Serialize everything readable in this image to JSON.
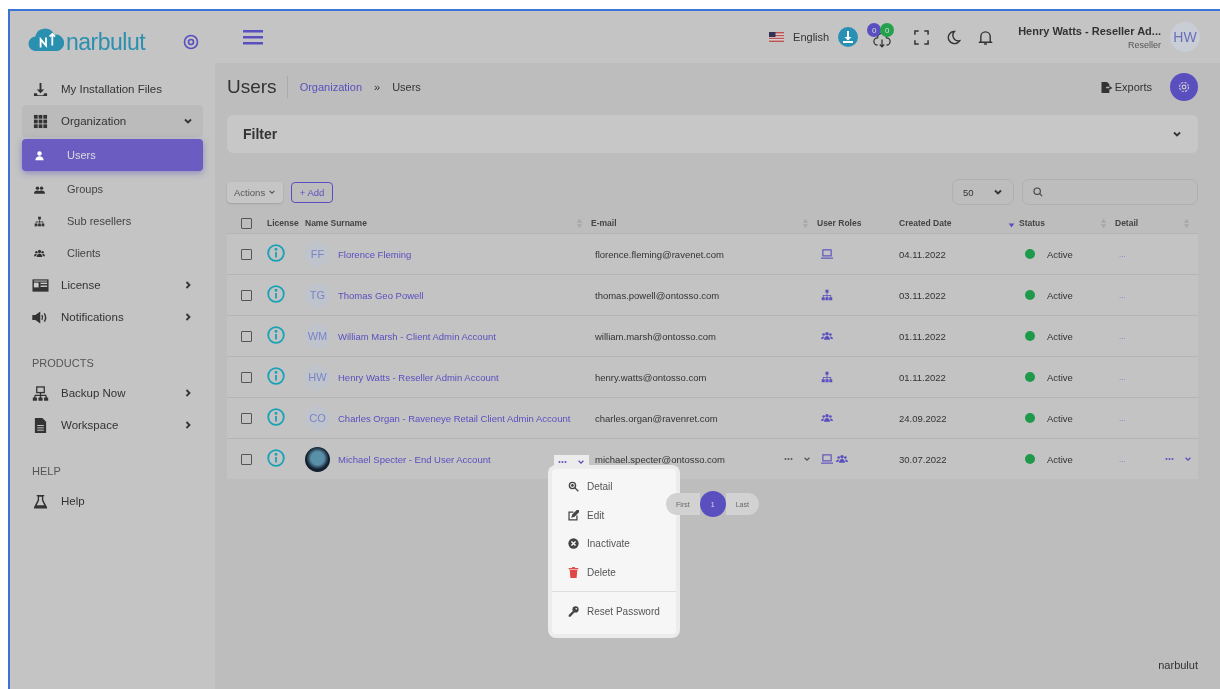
{
  "brand": {
    "name": "narbulut"
  },
  "sidebar": {
    "groups": [
      {
        "items": [
          {
            "label": "My Installation Files",
            "kind": "download"
          },
          {
            "label": "Organization",
            "kind": "grid",
            "expanded": true,
            "children": [
              {
                "label": "Users",
                "kind": "user",
                "selected": true
              },
              {
                "label": "Groups",
                "kind": "users",
                "selected": false
              },
              {
                "label": "Sub resellers",
                "kind": "sitemap",
                "selected": false
              },
              {
                "label": "Clients",
                "kind": "people",
                "selected": false
              }
            ]
          },
          {
            "label": "License",
            "kind": "card",
            "expanded": false
          },
          {
            "label": "Notifications",
            "kind": "speaker",
            "expanded": false
          }
        ]
      },
      {
        "heading": "PRODUCTS",
        "items": [
          {
            "label": "Backup Now",
            "kind": "network",
            "expanded": false
          },
          {
            "label": "Workspace",
            "kind": "file",
            "expanded": false
          }
        ]
      },
      {
        "heading": "HELP",
        "items": [
          {
            "label": "Help",
            "kind": "flask"
          }
        ]
      }
    ]
  },
  "topbar": {
    "language": "English",
    "badges": [
      {
        "count": "0",
        "color": "#5a4fc0"
      },
      {
        "count": "0",
        "color": "#23a14c"
      }
    ],
    "user_name": "Henry Watts - Reseller Ad...",
    "user_role": "Reseller",
    "user_initials": "HW"
  },
  "page": {
    "title": "Users",
    "breadcrumb": [
      "Organization",
      "Users"
    ],
    "separator": "»",
    "exports": "Exports"
  },
  "filter": {
    "title": "Filter",
    "expanded": false
  },
  "toolbar": {
    "actions": "Actions",
    "add": "+ Add",
    "page_size": "50"
  },
  "table": {
    "all_checked": false,
    "columns": [
      {
        "label": "License",
        "kind": "plain"
      },
      {
        "label": "Name Surname",
        "kind": "sortable"
      },
      {
        "label": "E-mail",
        "kind": "sortable"
      },
      {
        "label": "User Roles",
        "kind": "plain"
      },
      {
        "label": "Created Date",
        "kind": "sorted-desc"
      },
      {
        "label": "Status",
        "kind": "sortable"
      },
      {
        "label": "Detail",
        "kind": "sortable"
      }
    ],
    "rows": [
      {
        "checked": false,
        "avatar": {
          "kind": "initials",
          "text": "FF"
        },
        "name": "Florence Fleming",
        "email": "florence.fleming@ravenet.com",
        "roles": [
          {
            "kind": "computer"
          }
        ],
        "created": "04.11.2022",
        "status": "Active",
        "color": "#1f9a4a",
        "detail": "...",
        "hovered": false
      },
      {
        "checked": false,
        "avatar": {
          "kind": "initials",
          "text": "TG"
        },
        "name": "Thomas Geo Powell",
        "email": "thomas.powell@ontosso.com",
        "roles": [
          {
            "kind": "sitemap"
          }
        ],
        "created": "03.11.2022",
        "status": "Active",
        "color": "#1f9a4a",
        "detail": "...",
        "hovered": false
      },
      {
        "checked": false,
        "avatar": {
          "kind": "initials",
          "text": "WM"
        },
        "name": "William Marsh - Client Admin Account",
        "email": "william.marsh@ontosso.com",
        "roles": [
          {
            "kind": "people"
          }
        ],
        "created": "01.11.2022",
        "status": "Active",
        "color": "#1f9a4a",
        "detail": "...",
        "hovered": false
      },
      {
        "checked": false,
        "avatar": {
          "kind": "initials",
          "text": "HW"
        },
        "name": "Henry Watts - Reseller Admin Account",
        "email": "henry.watts@ontosso.com",
        "roles": [
          {
            "kind": "sitemap"
          }
        ],
        "created": "01.11.2022",
        "status": "Active",
        "color": "#1f9a4a",
        "detail": "...",
        "hovered": false
      },
      {
        "checked": false,
        "avatar": {
          "kind": "initials",
          "text": "CO"
        },
        "name": "Charles Organ - Raveneye Retail Client Admin Account",
        "email": "charles.organ@ravenret.com",
        "roles": [
          {
            "kind": "people"
          }
        ],
        "created": "24.09.2022",
        "status": "Active",
        "color": "#1f9a4a",
        "detail": "...",
        "hovered": false
      },
      {
        "checked": false,
        "avatar": {
          "kind": "photo"
        },
        "name": "Michael Specter - End User Account",
        "email": "michael.specter@ontosso.com",
        "roles": [
          {
            "kind": "computer"
          },
          {
            "kind": "people"
          }
        ],
        "created": "30.07.2022",
        "status": "Active",
        "color": "#1f9a4a",
        "detail": "...",
        "hovered": true
      }
    ]
  },
  "row_menu": {
    "open": true,
    "items": [
      {
        "label": "Detail",
        "kind": "zoom",
        "separated": false
      },
      {
        "label": "Edit",
        "kind": "edit",
        "separated": false
      },
      {
        "label": "Inactivate",
        "kind": "xcircle",
        "separated": false
      },
      {
        "label": "Delete",
        "kind": "trash",
        "separated": false
      },
      {
        "label": "Reset Password",
        "kind": "key",
        "separated": true
      }
    ]
  },
  "pagination": [
    {
      "label": "First",
      "selected": false
    },
    {
      "label": "1",
      "selected": true
    },
    {
      "label": "Last",
      "selected": false
    }
  ],
  "footer": {
    "brand": "narbulut"
  }
}
